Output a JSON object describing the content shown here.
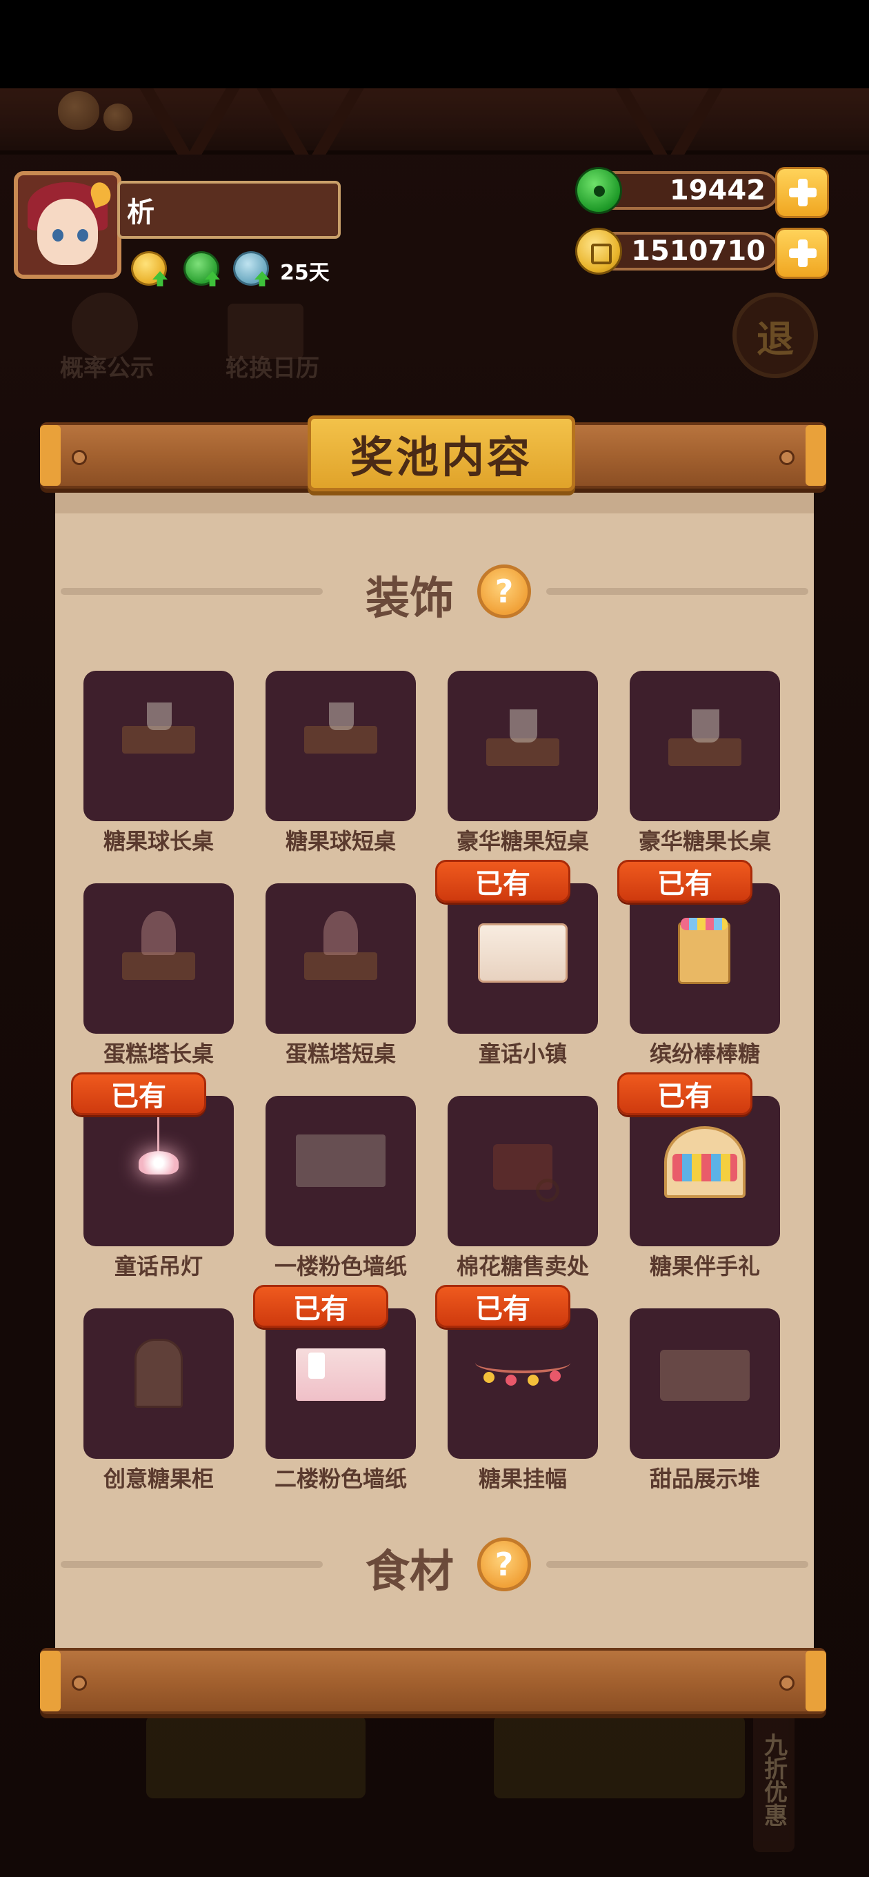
{
  "player": {
    "name": "析",
    "days": "25天"
  },
  "currency": {
    "jade": "19442",
    "coins": "1510710"
  },
  "background": {
    "prob_label": "概率公示",
    "calendar_label": "轮换日历",
    "exit_label": "退",
    "side_tab_label": "九折优惠"
  },
  "modal": {
    "title": "奖池内容",
    "section_decor": "装饰",
    "section_food": "食材",
    "help_glyph": "?",
    "owned_label": "已有",
    "items": [
      {
        "label": "糖果球长桌",
        "owned": false
      },
      {
        "label": "糖果球短桌",
        "owned": false
      },
      {
        "label": "豪华糖果短桌",
        "owned": false
      },
      {
        "label": "豪华糖果长桌",
        "owned": false
      },
      {
        "label": "蛋糕塔长桌",
        "owned": false
      },
      {
        "label": "蛋糕塔短桌",
        "owned": false
      },
      {
        "label": "童话小镇",
        "owned": true
      },
      {
        "label": "缤纷棒棒糖",
        "owned": true
      },
      {
        "label": "童话吊灯",
        "owned": true
      },
      {
        "label": "一楼粉色墙纸",
        "owned": false
      },
      {
        "label": "棉花糖售卖处",
        "owned": false
      },
      {
        "label": "糖果伴手礼",
        "owned": true
      },
      {
        "label": "创意糖果柜",
        "owned": false
      },
      {
        "label": "二楼粉色墙纸",
        "owned": true
      },
      {
        "label": "糖果挂幅",
        "owned": true
      },
      {
        "label": "甜品展示堆",
        "owned": false
      }
    ]
  }
}
